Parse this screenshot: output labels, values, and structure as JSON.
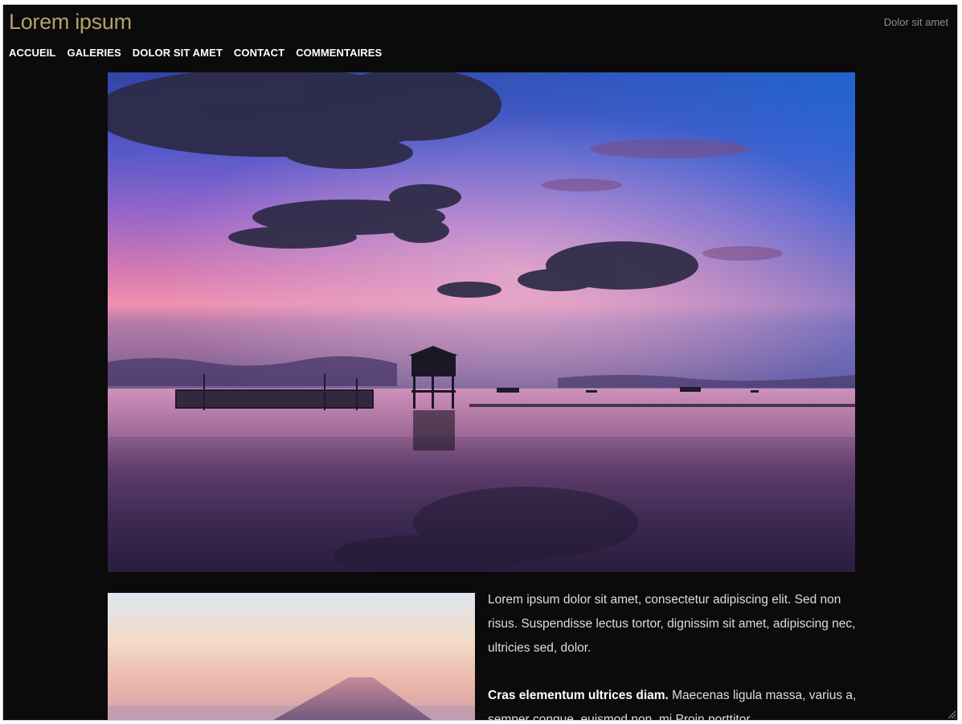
{
  "header": {
    "site_title": "Lorem ipsum",
    "tagline": "Dolor sit amet"
  },
  "nav": {
    "items": [
      {
        "label": "ACCUEIL"
      },
      {
        "label": "GALERIES"
      },
      {
        "label": "DOLOR SIT AMET"
      },
      {
        "label": "CONTACT"
      },
      {
        "label": "COMMENTAIRES"
      }
    ]
  },
  "main": {
    "hero_image_icon": "sunset-seascape-photo",
    "thumb_image_icon": "mountain-dusk-photo",
    "paragraph1": "Lorem ipsum dolor sit amet, consectetur adipiscing elit. Sed non risus. Suspendisse lectus tortor, dignissim sit amet, adipiscing nec, ultricies sed, dolor.",
    "paragraph2_bold": "Cras elementum ultrices diam.",
    "paragraph2_rest": " Maecenas ligula massa, varius a, semper congue, euismod non, mi Proin porttitor"
  },
  "colors": {
    "background": "#0b0b0b",
    "title": "#b5a06a",
    "nav_text": "#ffffff",
    "tagline": "#8e8e8e"
  }
}
